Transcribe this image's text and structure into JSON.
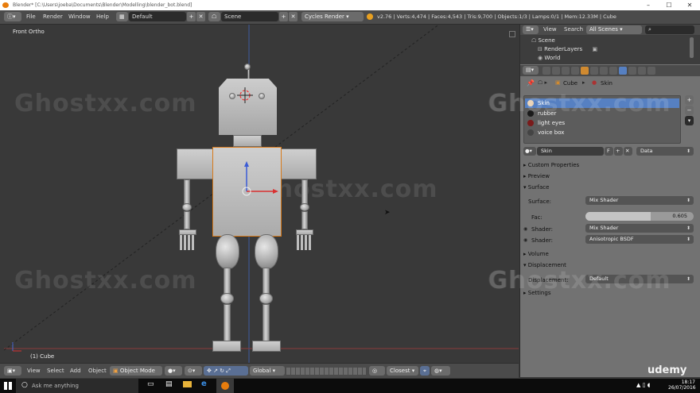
{
  "window": {
    "title": "Blender* [C:\\Users\\joeba\\Documents\\Blender\\Modelling\\blender_bot.blend]",
    "minimize": "–",
    "maximize": "☐",
    "close": "✕"
  },
  "header": {
    "menus": [
      "File",
      "Render",
      "Window",
      "Help"
    ],
    "layout": "Default",
    "scene": "Scene",
    "engine": "Cycles Render",
    "stats": "v2.76 | Verts:4,474 | Faces:4,543 | Tris:9,700 | Objects:1/3 | Lamps:0/1 | Mem:12.33M | Cube"
  },
  "viewport": {
    "view_label": "Front Ortho",
    "object_label": "(1) Cube",
    "watermark": "Ghostxx.com"
  },
  "viewport_bar": {
    "menus": [
      "View",
      "Select",
      "Add",
      "Object"
    ],
    "mode": "Object Mode",
    "orientation": "Global",
    "snap": "Closest"
  },
  "outliner": {
    "tabs": [
      "View",
      "Search"
    ],
    "filter": "All Scenes",
    "items": [
      "Scene",
      "RenderLayers",
      "World"
    ]
  },
  "properties": {
    "breadcrumb": [
      "Cube",
      "Skin"
    ],
    "materials": [
      "Skin",
      "rubber",
      "light eyes",
      "voice box"
    ],
    "selected_material": "Skin",
    "material_name": "Skin",
    "material_flag": "F",
    "data_link": "Data",
    "panels": {
      "custom_properties": "Custom Properties",
      "preview": "Preview",
      "surface": "Surface",
      "volume": "Volume",
      "displacement": "Displacement",
      "settings": "Settings"
    },
    "surface_label": "Surface:",
    "surface_value": "Mix Shader",
    "fac_label": "Fac:",
    "fac_value": "0.605",
    "fac_fraction": 0.605,
    "shader1_label": "Shader:",
    "shader1_value": "Mix Shader",
    "shader2_label": "Shader:",
    "shader2_value": "Anisotropic BSDF",
    "displacement_label": "Displacement:",
    "displacement_value": "Default"
  },
  "taskbar": {
    "search_placeholder": "Ask me anything",
    "time": "18:17",
    "date": "26/07/2016",
    "brand": "udemy"
  },
  "colors": {
    "accent_blue": "#5680c2",
    "header": "#4b4b4b",
    "panel": "#727272",
    "viewport": "#393939"
  }
}
